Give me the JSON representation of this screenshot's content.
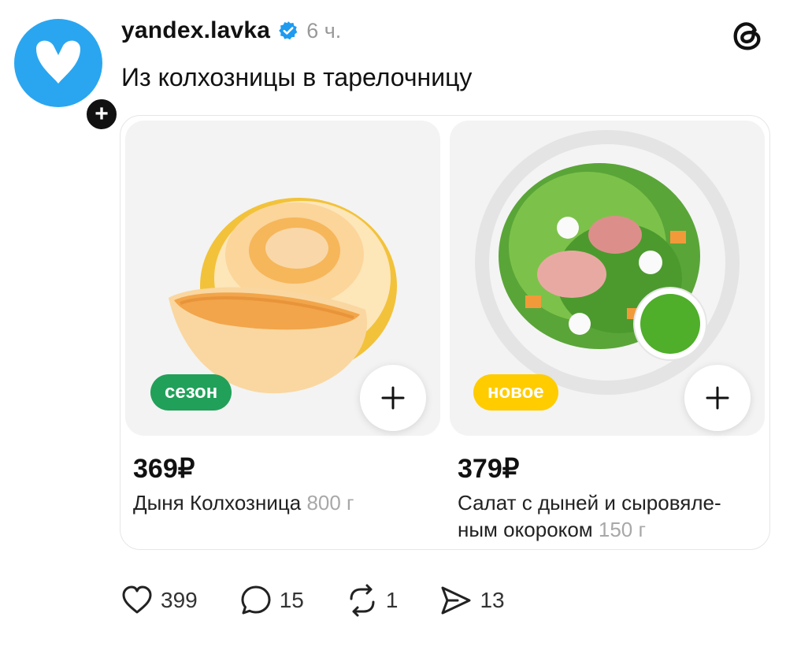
{
  "post": {
    "username": "yandex.lavka",
    "time": "6 ч.",
    "text": "Из колхозницы в тарелочницу"
  },
  "products": [
    {
      "badge": "сезон",
      "price": "369₽",
      "name": "Дыня Колхозница",
      "weight": "800 г",
      "image": "melon-image"
    },
    {
      "badge": "новое",
      "price": "379₽",
      "name": "Салат с дыней и сыровяле-ным окороком",
      "name_line1": "Салат с дыней и сыровяле-",
      "name_line2": "ным окороком",
      "weight": "150 г",
      "image": "salad-image"
    }
  ],
  "actions": {
    "likes": "399",
    "replies": "15",
    "reposts": "1",
    "shares": "13"
  },
  "colors": {
    "avatar": "#2aa6f0",
    "badge_season": "#21a05a",
    "badge_new": "#ffcc00",
    "verified": "#1d9bf0"
  },
  "icons": [
    "heart-icon",
    "comment-icon",
    "repost-icon",
    "share-icon",
    "verified-icon",
    "threads-logo-icon",
    "plus-icon"
  ]
}
